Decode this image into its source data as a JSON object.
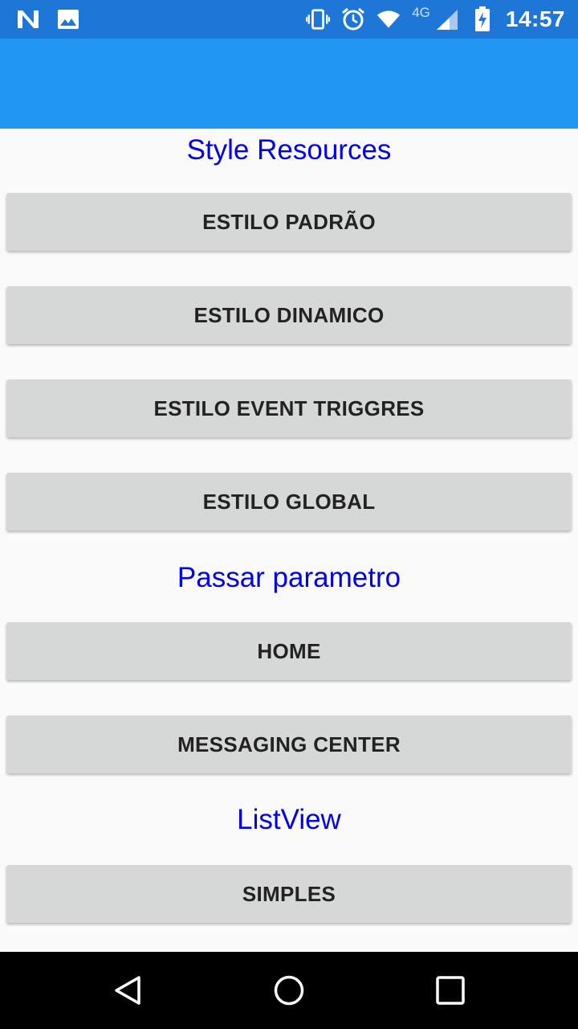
{
  "status_bar": {
    "time": "14:57",
    "network": "4G",
    "icons": [
      "n-icon",
      "image-icon",
      "vibrate-icon",
      "alarm-icon",
      "wifi-icon",
      "signal-icon",
      "battery-charging-icon"
    ]
  },
  "colors": {
    "status_bar": "#1e76d6",
    "app_bar": "#2196f3",
    "section_title": "#0000e6",
    "button_bg": "#d6d7d7",
    "background": "#fafafa"
  },
  "sections": [
    {
      "title": "Style Resources",
      "buttons": [
        "ESTILO PADRÃO",
        "ESTILO DINAMICO",
        "ESTILO EVENT TRIGGRES",
        "ESTILO GLOBAL"
      ]
    },
    {
      "title": "Passar parametro",
      "buttons": [
        "HOME",
        "MESSAGING CENTER"
      ]
    },
    {
      "title": "ListView",
      "buttons": [
        "SIMPLES"
      ]
    }
  ],
  "nav_bar": {
    "icons": [
      "back-icon",
      "home-icon",
      "recents-icon"
    ]
  }
}
